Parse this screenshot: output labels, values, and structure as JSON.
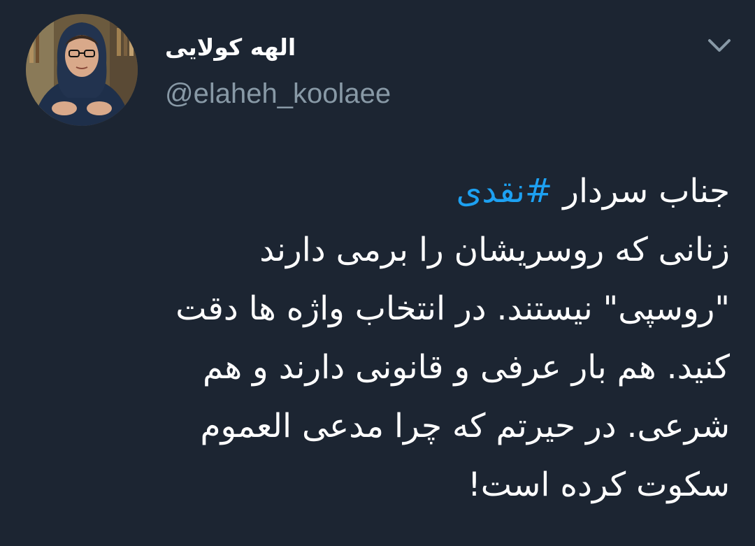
{
  "user": {
    "display_name": "الهه کولایی",
    "handle": "@elaheh_koolaee"
  },
  "tweet": {
    "line1_text": "جناب سردار ",
    "hashtag": "#نقدی",
    "lines": [
      "زنانی که روسریشان را برمی دارند",
      "\"روسپی\" نیستند. در انتخاب واژه ها دقت",
      "کنید. هم بار عرفی و قانونی دارند و هم",
      "شرعی. در حیرتم که چرا مدعی العموم",
      "سکوت کرده است!"
    ]
  },
  "icons": {
    "menu": "chevron-down-icon",
    "avatar": "profile-photo"
  },
  "colors": {
    "background": "#1c2532",
    "text": "#ffffff",
    "handle": "#8899a6",
    "hashtag": "#1da1f2"
  }
}
